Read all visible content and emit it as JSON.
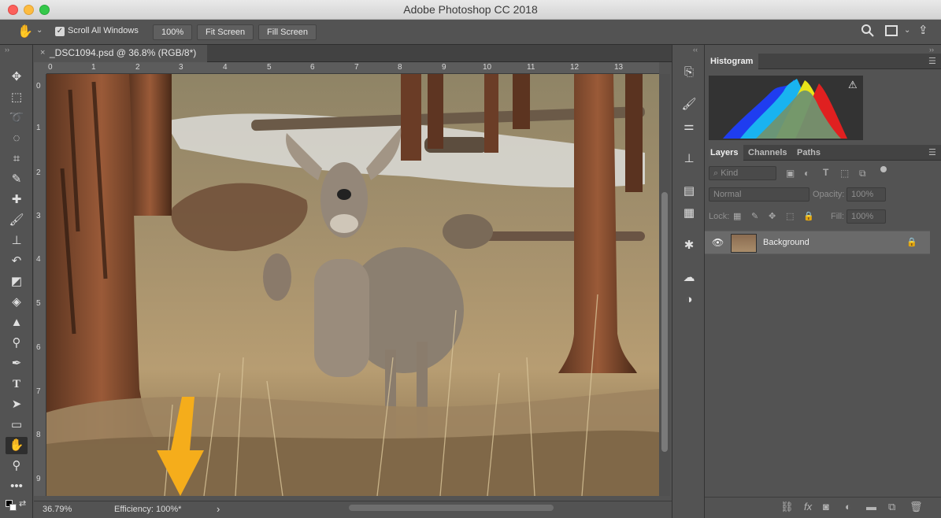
{
  "window": {
    "title": "Adobe Photoshop CC 2018"
  },
  "options_bar": {
    "scroll_all_windows_label": "Scroll All Windows",
    "scroll_all_windows_checked": true,
    "zoom_100_label": "100%",
    "fit_screen_label": "Fit Screen",
    "fill_screen_label": "Fill Screen"
  },
  "document": {
    "tab_title": "_DSC1094.psd @ 36.8% (RGB/8*)",
    "close_glyph": "×"
  },
  "rulers": {
    "horizontal": [
      "0",
      "1",
      "2",
      "3",
      "4",
      "5",
      "6",
      "7",
      "8",
      "9",
      "10",
      "11",
      "12",
      "13"
    ],
    "vertical": [
      "0",
      "1",
      "2",
      "3",
      "4",
      "5",
      "6",
      "7",
      "8",
      "9"
    ]
  },
  "status_bar": {
    "zoom": "36.79%",
    "info": "Efficiency: 100%*",
    "arrow": "›"
  },
  "panels": {
    "histogram": {
      "tab": "Histogram",
      "warning": "⚠"
    },
    "layers": {
      "tabs": [
        "Layers",
        "Channels",
        "Paths"
      ],
      "filter_kind": "Kind",
      "blend_mode": "Normal",
      "opacity_label": "Opacity:",
      "opacity_value": "100%",
      "lock_label": "Lock:",
      "fill_label": "Fill:",
      "fill_value": "100%",
      "layer_name": "Background"
    }
  },
  "colors": {
    "ui_dark": "#535353",
    "accent_arrow": "#f5ad1b"
  }
}
